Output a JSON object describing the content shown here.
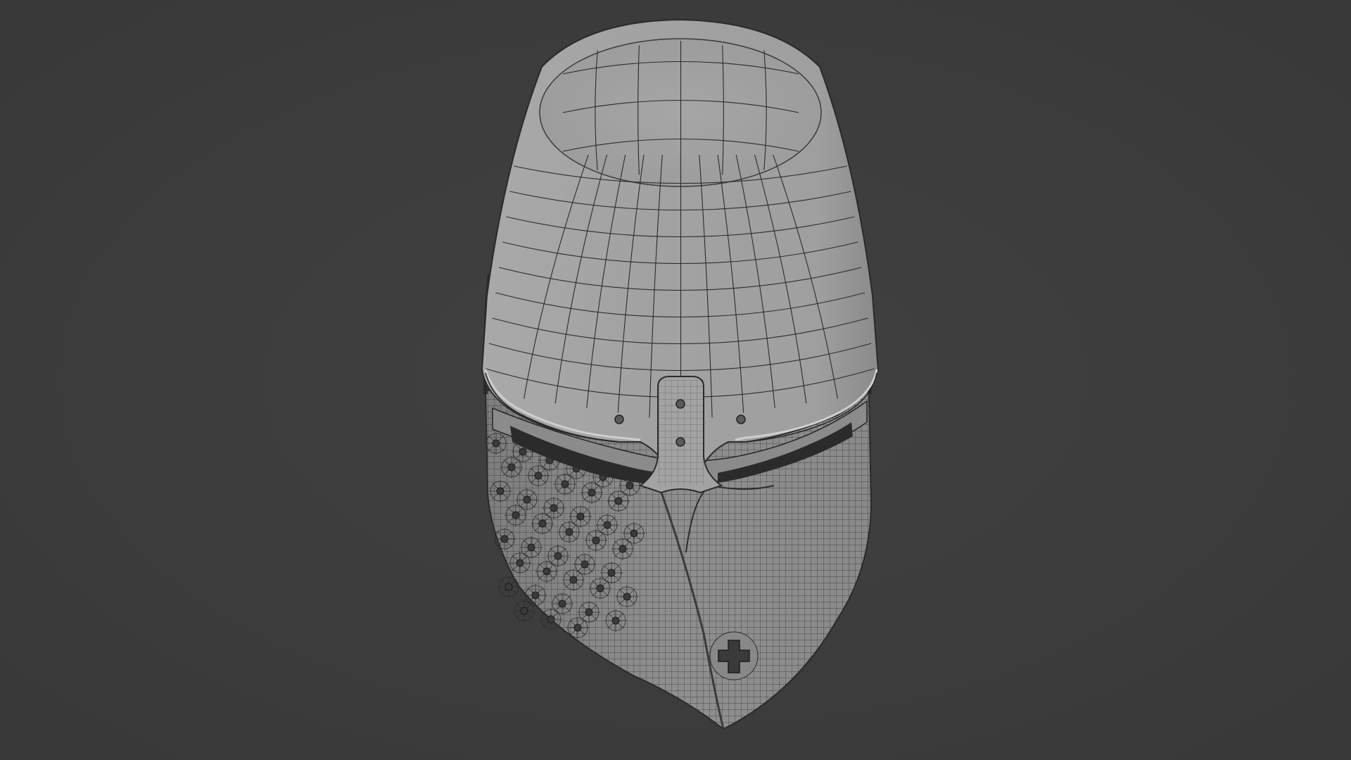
{
  "scene": {
    "subject": "great-helm-wireframe-render",
    "view": "3d-viewport",
    "shading": "solid-with-wireframe-overlay"
  },
  "colors": {
    "background": "#3d3d3d",
    "helm_surface": "#9a9a9a",
    "helm_surface_light": "#b3b3b3",
    "helm_shadow": "#6f6f6f",
    "wire": "#1e1e1e",
    "rivet": "#3a3a3a"
  },
  "features": {
    "breath_holes_count": 40,
    "cross_cutout": true,
    "eye_slit": true,
    "nasal_strap": true,
    "top_rivets": 4
  }
}
